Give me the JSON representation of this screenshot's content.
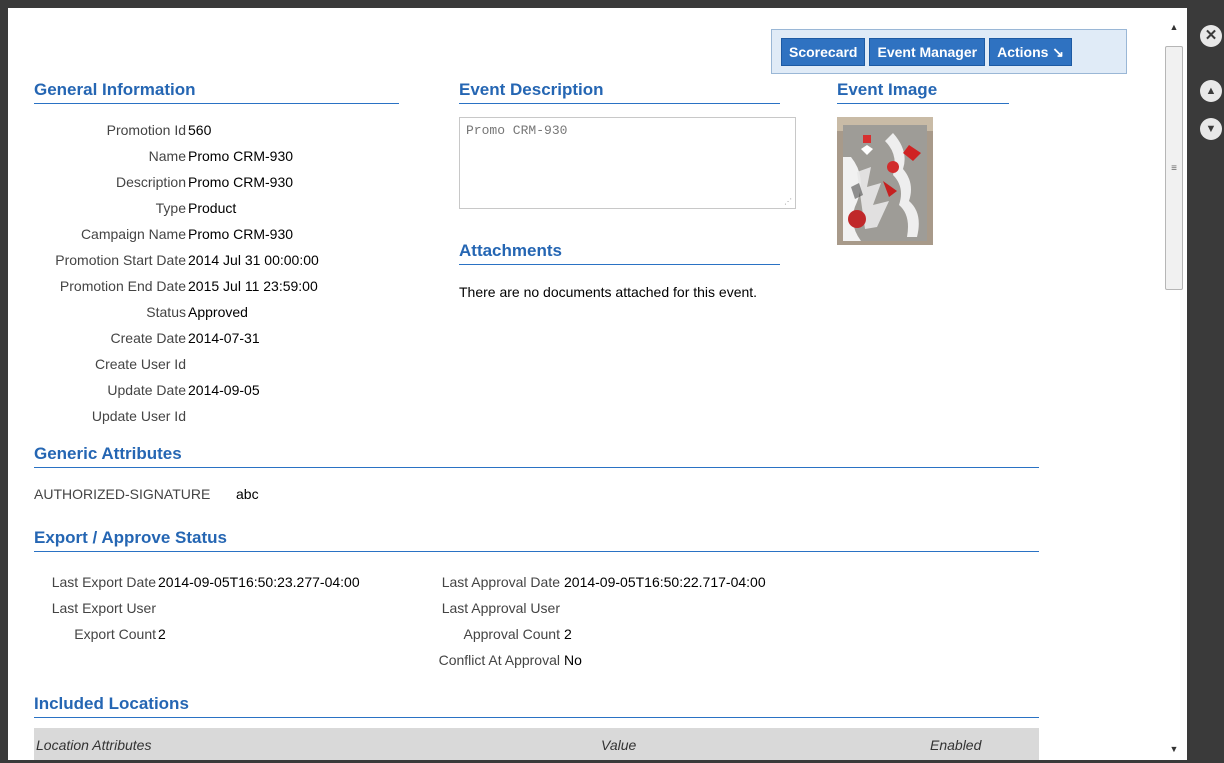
{
  "toolbar": {
    "scorecard_label": "Scorecard",
    "event_manager_label": "Event Manager",
    "actions_label": "Actions ↘"
  },
  "sections": {
    "general": "General Information",
    "event_description": "Event Description",
    "event_image": "Event Image",
    "attachments": "Attachments",
    "generic_attributes": "Generic Attributes",
    "export_approve": "Export / Approve Status",
    "included_locations": "Included Locations"
  },
  "general": {
    "rows": [
      {
        "label": "Promotion Id",
        "value": "560"
      },
      {
        "label": "Name",
        "value": "Promo CRM-930"
      },
      {
        "label": "Description",
        "value": "Promo CRM-930"
      },
      {
        "label": "Type",
        "value": "Product"
      },
      {
        "label": "Campaign Name",
        "value": "Promo CRM-930"
      },
      {
        "label": "Promotion Start Date",
        "value": "2014 Jul 31 00:00:00"
      },
      {
        "label": "Promotion End Date",
        "value": "2015 Jul 11 23:59:00"
      },
      {
        "label": "Status",
        "value": "Approved"
      },
      {
        "label": "Create Date",
        "value": "2014-07-31"
      },
      {
        "label": "Create User Id",
        "value": ""
      },
      {
        "label": "Update Date",
        "value": "2014-09-05"
      },
      {
        "label": "Update User Id",
        "value": ""
      }
    ]
  },
  "event_description": {
    "text": "Promo CRM-930"
  },
  "attachments": {
    "empty_text": "There are no documents attached for this event."
  },
  "generic_attributes": {
    "label": "AUTHORIZED-SIGNATURE",
    "value": "abc"
  },
  "export_status": {
    "last_export_date_label": "Last Export Date",
    "last_export_date": "2014-09-05T16:50:23.277-04:00",
    "last_export_user_label": "Last Export User",
    "last_export_user": "",
    "export_count_label": "Export Count",
    "export_count": "2",
    "last_approval_date_label": "Last Approval Date",
    "last_approval_date": "2014-09-05T16:50:22.717-04:00",
    "last_approval_user_label": "Last Approval User",
    "last_approval_user": "",
    "approval_count_label": "Approval Count",
    "approval_count": "2",
    "conflict_label": "Conflict At Approval",
    "conflict": "No"
  },
  "locations_table": {
    "columns": [
      "Location Attributes",
      "Value",
      "Enabled"
    ]
  },
  "side_buttons": {
    "close_icon": "close-icon",
    "up_icon": "arrow-up-icon",
    "down_icon": "arrow-down-icon"
  },
  "colors": {
    "accent": "#2566b3",
    "button": "#2f72c1",
    "toolbar_bg": "#e0ebf7"
  }
}
